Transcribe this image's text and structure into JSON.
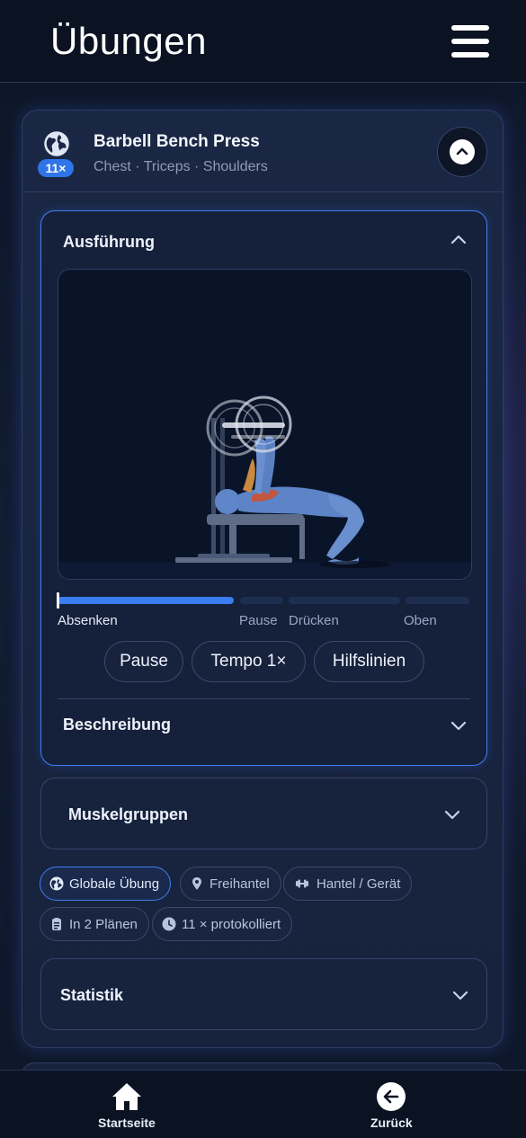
{
  "header": {
    "title": "Übungen",
    "menu_icon": "hamburger-menu-icon"
  },
  "exercise": {
    "name": "Barbell Bench Press",
    "muscles": "Chest · Triceps · Shoulders",
    "count_badge": "11×",
    "icon": "globe-icon"
  },
  "execution": {
    "title": "Ausführung",
    "progress": 0.43,
    "phases": [
      {
        "label": "Absenken",
        "active": true
      },
      {
        "label": "Pause",
        "active": false
      },
      {
        "label": "Drücken",
        "active": false
      },
      {
        "label": "Oben",
        "active": false
      }
    ],
    "buttons": {
      "pause": "Pause",
      "tempo": "Tempo 1×",
      "guides": "Hilfslinien"
    },
    "description_title": "Beschreibung"
  },
  "muscle_groups": {
    "title": "Muskelgruppen"
  },
  "chips": [
    {
      "label": "Globale Übung",
      "icon": "globe-icon",
      "primary": true
    },
    {
      "label": "Freihantel",
      "icon": "location-pin-icon",
      "primary": false
    },
    {
      "label": "Hantel / Gerät",
      "icon": "dumbbell-icon",
      "primary": false
    },
    {
      "label": "In 2 Plänen",
      "icon": "clipboard-icon",
      "primary": false
    },
    {
      "label": "11 × protokolliert",
      "icon": "clock-icon",
      "primary": false
    }
  ],
  "statistics": {
    "title": "Statistik"
  },
  "bottom_nav": {
    "home": {
      "label": "Startseite",
      "icon": "home-icon"
    },
    "back": {
      "label": "Zurück",
      "icon": "arrow-left-circle-icon"
    }
  },
  "colors": {
    "accent": "#3a7df0",
    "background": "#121d33",
    "card": "#1a2744"
  }
}
